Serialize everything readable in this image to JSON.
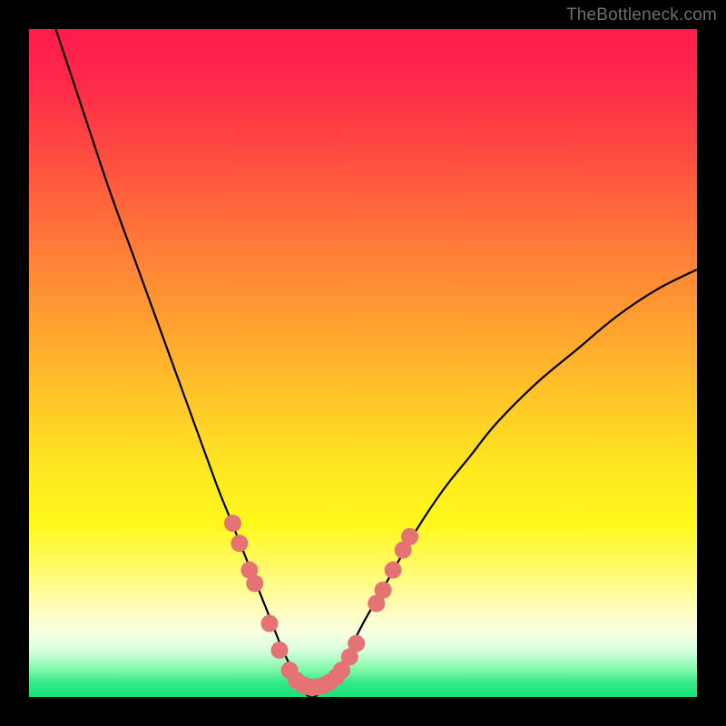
{
  "watermark": "TheBottleneck.com",
  "colors": {
    "background": "#000000",
    "curve": "#000000",
    "dot_fill": "#e57373",
    "dot_stroke": "#c05555"
  },
  "chart_data": {
    "type": "line",
    "title": "",
    "xlabel": "",
    "ylabel": "",
    "xlim": [
      0,
      100
    ],
    "ylim": [
      0,
      100
    ],
    "annotations": [],
    "series": [
      {
        "name": "bottleneck-curve",
        "description": "V-shaped bottleneck curve; y is bottleneck percentage, minimum near x≈42 at y≈0",
        "x": [
          4,
          8,
          12,
          16,
          20,
          24,
          28,
          30,
          32,
          34,
          36,
          38,
          40,
          42,
          44,
          46,
          48,
          50,
          54,
          58,
          62,
          66,
          70,
          76,
          82,
          88,
          94,
          100
        ],
        "y": [
          100,
          88,
          76,
          65,
          54,
          43,
          32,
          27,
          22,
          17,
          12,
          7,
          3,
          0,
          1,
          3,
          7,
          11,
          18,
          25,
          31,
          36,
          41,
          47,
          52,
          57,
          61,
          64
        ]
      }
    ],
    "dots": {
      "name": "sample-points",
      "description": "Highlighted sample markers on the curve near the valley",
      "points": [
        {
          "x": 30.5,
          "y": 26
        },
        {
          "x": 31.5,
          "y": 23
        },
        {
          "x": 33.0,
          "y": 19
        },
        {
          "x": 33.8,
          "y": 17
        },
        {
          "x": 36.0,
          "y": 11
        },
        {
          "x": 37.5,
          "y": 7
        },
        {
          "x": 39.0,
          "y": 4
        },
        {
          "x": 40.0,
          "y": 2.5
        },
        {
          "x": 41.0,
          "y": 1.8
        },
        {
          "x": 42.0,
          "y": 1.5
        },
        {
          "x": 43.0,
          "y": 1.5
        },
        {
          "x": 44.0,
          "y": 1.7
        },
        {
          "x": 45.0,
          "y": 2.2
        },
        {
          "x": 46.0,
          "y": 3
        },
        {
          "x": 46.8,
          "y": 4
        },
        {
          "x": 48.0,
          "y": 6
        },
        {
          "x": 49.0,
          "y": 8
        },
        {
          "x": 52.0,
          "y": 14
        },
        {
          "x": 53.0,
          "y": 16
        },
        {
          "x": 54.5,
          "y": 19
        },
        {
          "x": 56.0,
          "y": 22
        },
        {
          "x": 57.0,
          "y": 24
        }
      ]
    }
  }
}
